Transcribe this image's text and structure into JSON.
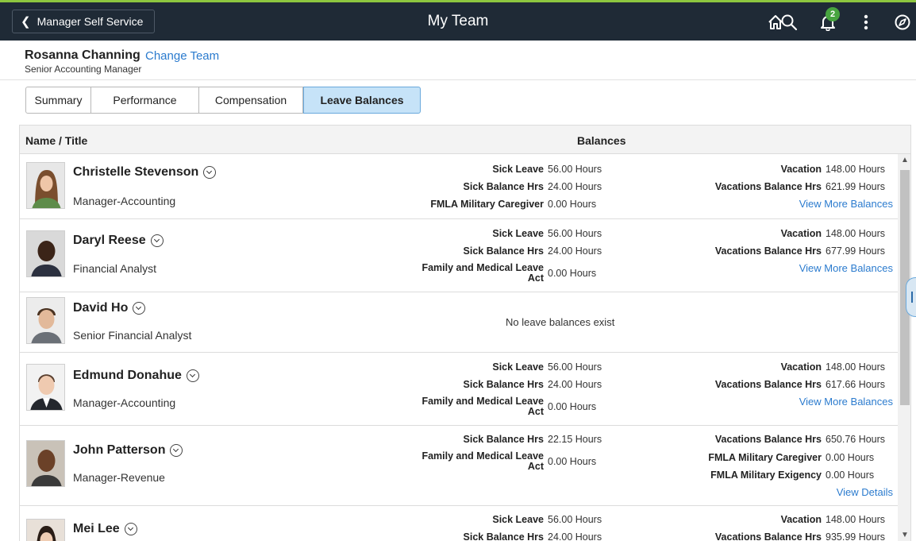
{
  "header": {
    "back_label": "Manager Self Service",
    "title": "My Team",
    "notification_count": "2",
    "accent_color": "#8dc63f",
    "bar_color": "#1f2a36"
  },
  "manager": {
    "name": "Rosanna Channing",
    "change_team": "Change Team",
    "title": "Senior Accounting Manager"
  },
  "tabs": [
    "Summary",
    "Performance",
    "Compensation",
    "Leave Balances"
  ],
  "active_tab": "Leave Balances",
  "grid": {
    "col_name": "Name / Title",
    "col_balances": "Balances"
  },
  "employees": [
    {
      "name": "Christelle Stevenson",
      "title": "Manager-Accounting",
      "mid": [
        {
          "label": "Sick Leave",
          "value": "56.00 Hours"
        },
        {
          "label": "Sick Balance Hrs",
          "value": "24.00 Hours"
        },
        {
          "label": "FMLA Military Caregiver",
          "value": "0.00 Hours"
        }
      ],
      "right": [
        {
          "label": "Vacation",
          "value": "148.00 Hours"
        },
        {
          "label": "Vacations Balance Hrs",
          "value": "621.99 Hours"
        }
      ],
      "link": "View More Balances"
    },
    {
      "name": "Daryl Reese",
      "title": "Financial Analyst",
      "mid": [
        {
          "label": "Sick Leave",
          "value": "56.00 Hours"
        },
        {
          "label": "Sick Balance Hrs",
          "value": "24.00 Hours"
        },
        {
          "label_line1": "Family and Medical Leave",
          "label_line2": "Act",
          "value": "0.00 Hours"
        }
      ],
      "right": [
        {
          "label": "Vacation",
          "value": "148.00 Hours"
        },
        {
          "label": "Vacations Balance Hrs",
          "value": "677.99 Hours"
        }
      ],
      "link": "View More Balances"
    },
    {
      "name": "David Ho",
      "title": "Senior Financial Analyst",
      "message": "No leave balances exist"
    },
    {
      "name": "Edmund Donahue",
      "title": "Manager-Accounting",
      "mid": [
        {
          "label": "Sick Leave",
          "value": "56.00 Hours"
        },
        {
          "label": "Sick Balance Hrs",
          "value": "24.00 Hours"
        },
        {
          "label_line1": "Family and Medical Leave",
          "label_line2": "Act",
          "value": "0.00 Hours"
        }
      ],
      "right": [
        {
          "label": "Vacation",
          "value": "148.00 Hours"
        },
        {
          "label": "Vacations Balance Hrs",
          "value": "617.66 Hours"
        }
      ],
      "link": "View More Balances"
    },
    {
      "name": "John Patterson",
      "title": "Manager-Revenue",
      "mid": [
        {
          "label": "Sick Balance Hrs",
          "value": "22.15 Hours"
        },
        {
          "label_line1": "Family and Medical Leave",
          "label_line2": "Act",
          "value": "0.00 Hours"
        }
      ],
      "right": [
        {
          "label": "Vacations Balance Hrs",
          "value": "650.76 Hours"
        },
        {
          "label": "FMLA Military Caregiver",
          "value": "0.00 Hours"
        },
        {
          "label": "FMLA Military Exigency",
          "value": "0.00 Hours"
        }
      ],
      "link": "View Details"
    },
    {
      "name": "Mei Lee",
      "mid": [
        {
          "label": "Sick Leave",
          "value": "56.00 Hours"
        },
        {
          "label": "Sick Balance Hrs",
          "value": "24.00 Hours"
        }
      ],
      "right": [
        {
          "label": "Vacation",
          "value": "148.00 Hours"
        },
        {
          "label": "Vacations Balance Hrs",
          "value": "935.99 Hours"
        }
      ]
    }
  ]
}
